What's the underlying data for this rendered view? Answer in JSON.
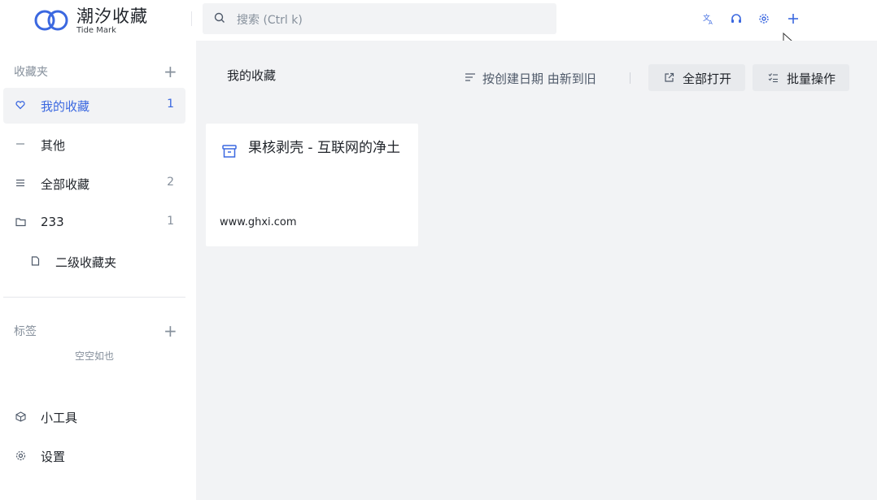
{
  "app": {
    "name": "潮汐收藏",
    "subtitle": "Tide Mark"
  },
  "search": {
    "placeholder": "搜索 (Ctrl k)"
  },
  "toolbar": {
    "icons": [
      "translate-icon",
      "headset-icon",
      "settings-gear-icon",
      "plus-icon"
    ]
  },
  "sidebar": {
    "favorites_header": "收藏夹",
    "items": [
      {
        "label": "我的收藏",
        "count": "1",
        "icon": "heart-icon",
        "active": true
      },
      {
        "label": "其他",
        "count": "",
        "icon": "dash-icon",
        "active": false
      },
      {
        "label": "全部收藏",
        "count": "2",
        "icon": "list-icon",
        "active": false
      },
      {
        "label": "233",
        "count": "1",
        "icon": "folder-icon",
        "active": false
      },
      {
        "label": "二级收藏夹",
        "count": "",
        "icon": "file-icon",
        "active": false
      }
    ],
    "tags_header": "标签",
    "tags_empty": "空空如也",
    "tools_label": "小工具",
    "settings_label": "设置"
  },
  "main": {
    "title": "我的收藏",
    "sort_label": "按创建日期 由新到旧",
    "open_all_label": "全部打开",
    "batch_label": "批量操作",
    "cards": [
      {
        "title": "果核剥壳 - 互联网的净土",
        "url": "www.ghxi.com",
        "icon": "archive-box-icon"
      }
    ]
  },
  "colors": {
    "accent": "#3b68e0",
    "main_bg": "#f2f3f5",
    "active_bg": "#f2f3f5"
  }
}
